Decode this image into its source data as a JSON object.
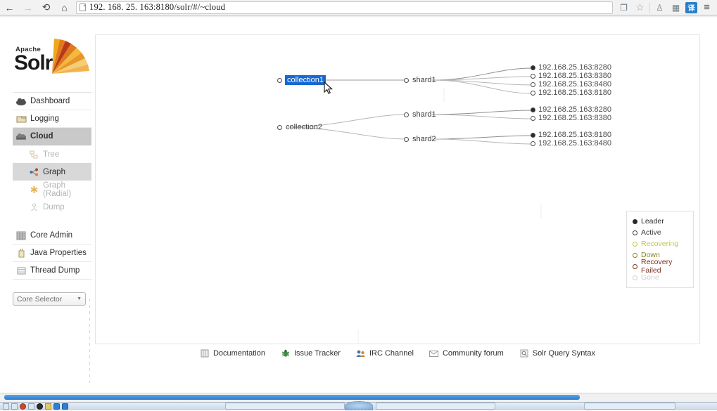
{
  "browser": {
    "back_icon": "back-arrow-icon",
    "forward_icon": "forward-arrow-icon",
    "reload_icon": "reload-icon",
    "home_icon": "home-icon",
    "url_host": "192. 168. 25. 163",
    "url_rest": ":8180/solr/#/~cloud",
    "url_full": "192. 168. 25. 163:8180/solr/#/~cloud",
    "toolbar_icons": [
      "copy-translate-icon",
      "star-bookmark-icon",
      "evernote-icon",
      "grid-icon",
      "translate-icon",
      "menu-icon"
    ],
    "translate_glyph": "译",
    "star_glyph": "☆",
    "menu_glyph": "≡"
  },
  "sidebar": {
    "logo": {
      "apache": "Apache",
      "solr": "Solr"
    },
    "items": [
      {
        "label": "Dashboard",
        "icon": "cloud-dashboard-icon",
        "active": false
      },
      {
        "label": "Logging",
        "icon": "logging-icon",
        "active": false
      },
      {
        "label": "Cloud",
        "icon": "cloud-icon",
        "active": true
      }
    ],
    "subitems": [
      {
        "label": "Tree",
        "icon": "tree-icon",
        "active": false
      },
      {
        "label": "Graph",
        "icon": "graph-icon",
        "active": true
      },
      {
        "label": "Graph (Radial)",
        "icon": "graph-radial-icon",
        "active": false
      },
      {
        "label": "Dump",
        "icon": "dump-icon",
        "active": false
      }
    ],
    "items2": [
      {
        "label": "Core Admin",
        "icon": "core-admin-icon"
      },
      {
        "label": "Java Properties",
        "icon": "java-properties-icon"
      },
      {
        "label": "Thread Dump",
        "icon": "thread-dump-icon"
      }
    ],
    "core_selector": {
      "label": "Core Selector",
      "caret": "▼"
    }
  },
  "graph": {
    "collections": [
      {
        "label": "collection1",
        "selected": true
      },
      {
        "label": "collection2",
        "selected": false
      }
    ],
    "shards": [
      {
        "label": "shard1"
      },
      {
        "label": "shard1"
      },
      {
        "label": "shard2"
      }
    ],
    "replicas_group1": [
      {
        "label": "192.168.25.163:8280",
        "state": "leader"
      },
      {
        "label": "192.168.25.163:8380",
        "state": "active"
      },
      {
        "label": "192.168.25.163:8480",
        "state": "active"
      },
      {
        "label": "192.168.25.163:8180",
        "state": "active"
      }
    ],
    "replicas_group2": [
      {
        "label": "192.168.25.163:8280",
        "state": "leader"
      },
      {
        "label": "192.168.25.163:8380",
        "state": "active"
      }
    ],
    "replicas_group3": [
      {
        "label": "192.168.25.163:8180",
        "state": "leader"
      },
      {
        "label": "192.168.25.163:8480",
        "state": "active"
      }
    ]
  },
  "legend": {
    "items": [
      {
        "label": "Leader",
        "color": "#2b2b2b",
        "filled": true
      },
      {
        "label": "Active",
        "color": "#3b3b3b",
        "filled": false
      },
      {
        "label": "Recovering",
        "color": "#c3c93f",
        "filled": false
      },
      {
        "label": "Down",
        "color": "#8a8326",
        "filled": false
      },
      {
        "label": "Recovery Failed",
        "color": "#7a2f22",
        "filled": false
      },
      {
        "label": "Gone",
        "color": "#d6d6d6",
        "filled": false
      }
    ]
  },
  "footer": {
    "links": [
      {
        "label": "Documentation",
        "icon": "book-icon"
      },
      {
        "label": "Issue Tracker",
        "icon": "bug-icon"
      },
      {
        "label": "IRC Channel",
        "icon": "people-icon"
      },
      {
        "label": "Community forum",
        "icon": "envelope-icon"
      },
      {
        "label": "Solr Query Syntax",
        "icon": "query-icon"
      }
    ]
  },
  "colors": {
    "selection_blue": "#1768d1",
    "sidebar_active": "#c9c9c9",
    "scrollbar_blue": "#2a79cc"
  }
}
